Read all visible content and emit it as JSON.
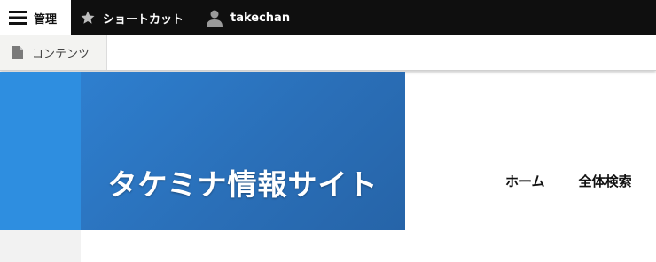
{
  "toolbar": {
    "manage_label": "管理",
    "shortcuts_label": "ショートカット",
    "user_label": "takechan"
  },
  "tray": {
    "content_label": "コンテンツ"
  },
  "site": {
    "name": "タケミナ情報サイト"
  },
  "nav": {
    "items": [
      {
        "label": "ホーム"
      },
      {
        "label": "全体検索"
      }
    ]
  },
  "colors": {
    "toolbar_bg": "#0f0f0f",
    "banner_blue": "#2a6fb8",
    "side_blue": "#2e8ee0"
  }
}
